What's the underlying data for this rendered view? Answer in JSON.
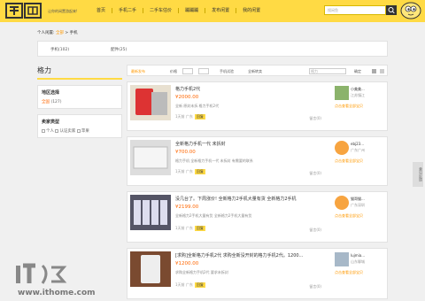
{
  "header": {
    "tagline": "让你的闲置游起来!",
    "nav": [
      "首页",
      "手机二手",
      "二手车估价",
      "蹦蹦蹦",
      "发布闲置",
      "我的闲置"
    ],
    "search_placeholder": "搜闲鱼"
  },
  "breadcrumb": {
    "label": "个人闲置:",
    "current": "全部",
    "sep": ">",
    "leaf": "手机"
  },
  "subtabs": [
    "手机(102)",
    "配件(25)"
  ],
  "left": {
    "title": "格力",
    "region_title": "地区选择",
    "region_value": "全国",
    "region_count": "(127)",
    "buyer_title": "卖家类型",
    "buyer_opt1": "个人",
    "buyer_opt2": "认证卖家",
    "buyer_opt3": "苹果"
  },
  "filter": {
    "sort": "最新发布",
    "price_label": "价格",
    "tag1": "手机试验",
    "tag2": "全新转卖",
    "input_placeholder": "格力",
    "ok": "确定"
  },
  "items": [
    {
      "title": "格力手机2代",
      "price": "¥2000.00",
      "desc": "全新 原封未拆 格力手机2代",
      "time": "1天前",
      "loc": "广东",
      "badge": "回复",
      "msg": "留言(0)",
      "user": "小美美...",
      "uloc": "江苏镇江",
      "more": "点击查看全部宝贝"
    },
    {
      "title": "全新格力手机一代 未拆封",
      "price": "¥700.00",
      "desc": "格力手机 全新格力手机一代 未拆封 有需要的联系",
      "time": "1天前",
      "loc": "广东",
      "badge": "回复",
      "msg": "留言(0)",
      "user": "ebj23...",
      "uloc": "广东广州",
      "more": "点击查看全部宝贝"
    },
    {
      "title": "没几台了。下周涨价! 全新格力2手机大量有货 全新格力2手机",
      "price": "¥2199.00",
      "desc": "全新格力2手机大量有货 全新格力2手机大量有货",
      "time": "1天前",
      "loc": "广东",
      "badge": "回复",
      "msg": "留言(0)",
      "user": "猫哥猫...",
      "uloc": "广东深圳",
      "more": "点击查看全部宝贝"
    },
    {
      "title": "[求购]全新格力手机2代 求购全新没开封的格力手机2代。1200...",
      "price": "¥1200.00",
      "desc": "求购全新格力手机2代 要求未拆封",
      "time": "1天前",
      "loc": "广东",
      "badge": "回复",
      "msg": "留言(0)",
      "user": "lujmia...",
      "uloc": "山东聊城",
      "more": "点击查看全部宝贝"
    }
  ],
  "side_tab": "意见反馈",
  "watermark": {
    "brand": "IT之家",
    "url": "www.ithome.com"
  },
  "colors": {
    "brand": "#ffda44",
    "price": "#ff6600",
    "link": "#ff9900"
  }
}
